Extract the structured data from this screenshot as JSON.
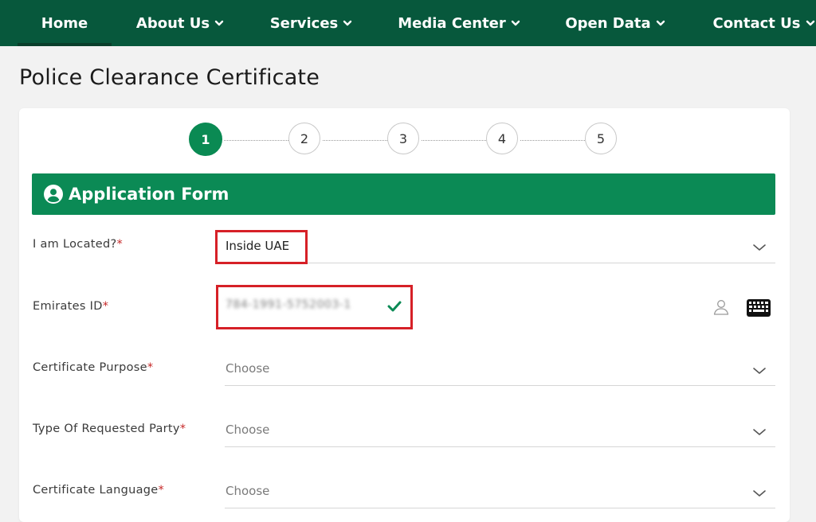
{
  "nav": {
    "items": [
      {
        "label": "Home"
      },
      {
        "label": "About Us"
      },
      {
        "label": "Services"
      },
      {
        "label": "Media Center"
      },
      {
        "label": "Open Data"
      },
      {
        "label": "Contact Us"
      }
    ]
  },
  "page": {
    "title": "Police Clearance Certificate"
  },
  "steps": [
    "1",
    "2",
    "3",
    "4",
    "5"
  ],
  "active_step": 1,
  "form": {
    "header": "Application Form",
    "fields": [
      {
        "label": "I am Located?",
        "required": "*",
        "value": "Inside UAE"
      },
      {
        "label": "Emirates ID",
        "required": "*",
        "value": "784-1991-5752003-1"
      },
      {
        "label": "Certificate Purpose",
        "required": "*",
        "placeholder": "Choose"
      },
      {
        "label": "Type Of Requested Party",
        "required": "*",
        "placeholder": "Choose"
      },
      {
        "label": "Certificate Language",
        "required": "*",
        "placeholder": "Choose"
      }
    ]
  },
  "colors": {
    "nav_bg": "#07583c",
    "accent": "#0b8a55",
    "highlight_box": "#d62027",
    "required": "#c62828"
  },
  "icons": {
    "nav_dropdown": "chevron-down-icon",
    "form_header": "user-circle-icon",
    "valid": "check-icon",
    "user": "user-outline-icon",
    "keyboard": "keyboard-icon",
    "select": "chevron-down-icon"
  }
}
